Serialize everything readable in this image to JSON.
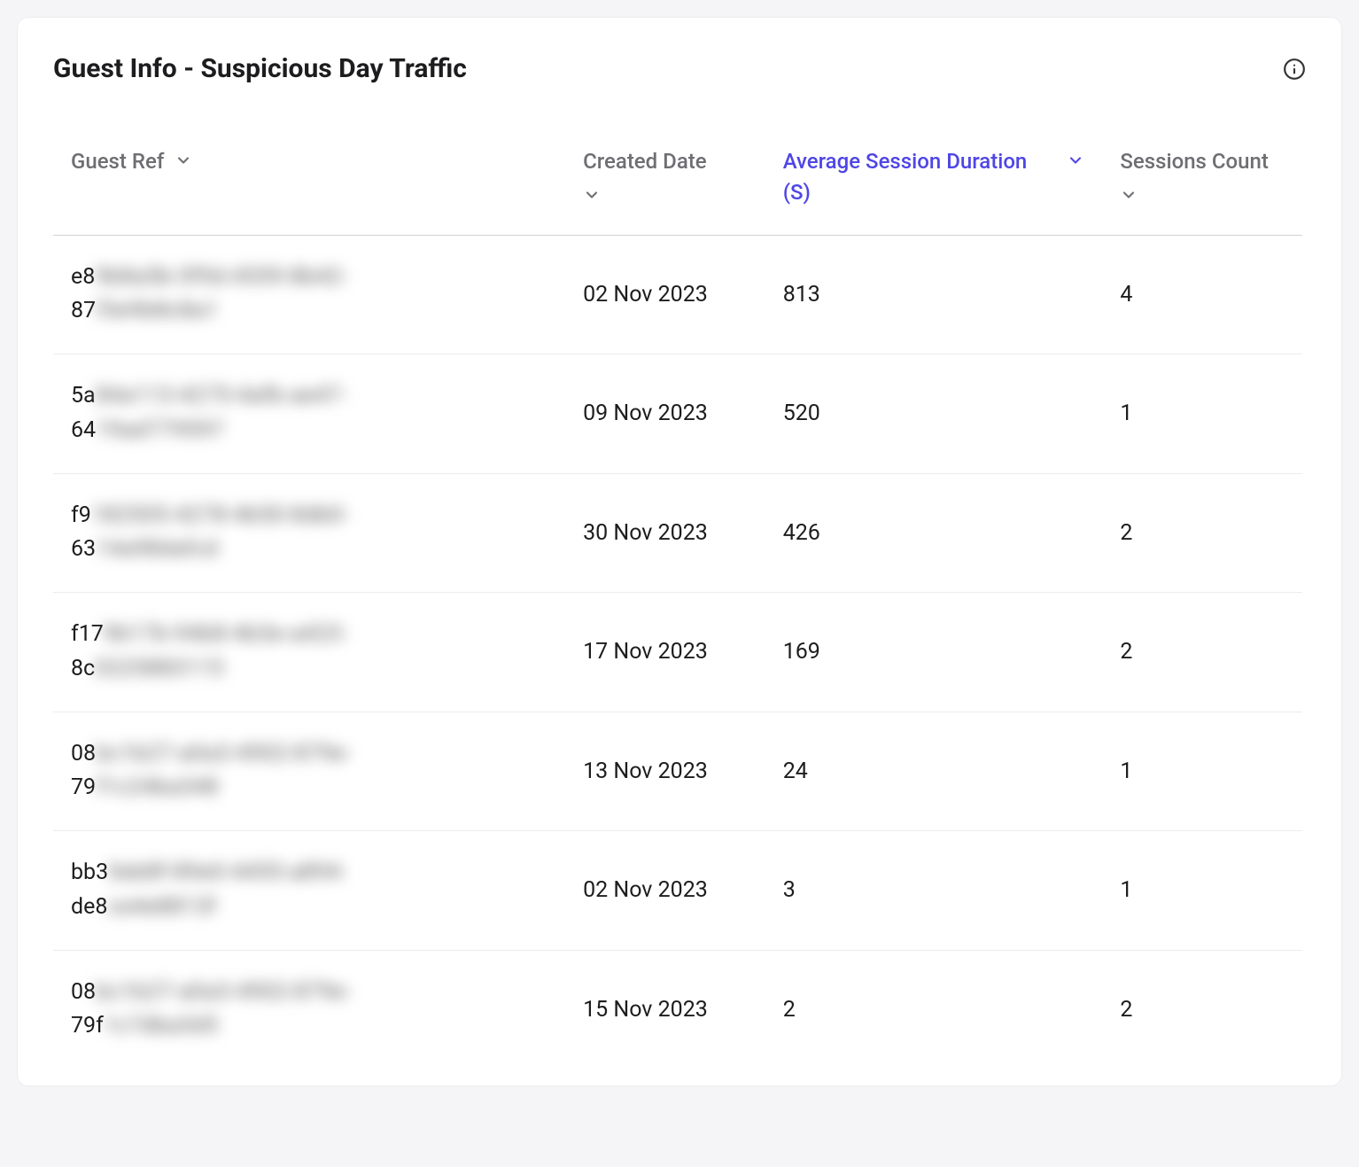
{
  "card": {
    "title": "Guest Info - Suspicious Day Traffic"
  },
  "table": {
    "columns": [
      {
        "key": "guest_ref",
        "label": "Guest Ref",
        "sorted": false,
        "chevron_inline": true
      },
      {
        "key": "created_date",
        "label": "Created Date",
        "sorted": false,
        "chevron_inline": false
      },
      {
        "key": "avg_session",
        "label": "Average Session Duration (S)",
        "sorted": true,
        "chevron_inline": true
      },
      {
        "key": "sessions_count",
        "label": "Sessions Count",
        "sorted": false,
        "chevron_inline": false
      }
    ],
    "rows": [
      {
        "guest_ref_line1_prefix": "e8",
        "guest_ref_line1_masked": "9b8a5b-5f9d-4559-8b42-",
        "guest_ref_line2_prefix": "87",
        "guest_ref_line2_masked": "f3e9b8c8a1",
        "created_date": "02 Nov 2023",
        "avg_session": "813",
        "sessions_count": "4"
      },
      {
        "guest_ref_line1_prefix": "5a",
        "guest_ref_line1_masked": "84a113-4275-4afb-ae47-",
        "guest_ref_line2_prefix": "64",
        "guest_ref_line2_masked": "19ad779597",
        "created_date": "09 Nov 2023",
        "avg_session": "520",
        "sessions_count": "1"
      },
      {
        "guest_ref_line1_prefix": "f9",
        "guest_ref_line1_masked": "182505-4278-4b50-8db0-",
        "guest_ref_line2_prefix": "63",
        "guest_ref_line2_masked": "14a98dafcd",
        "created_date": "30 Nov 2023",
        "avg_session": "426",
        "sessions_count": "2"
      },
      {
        "guest_ref_line1_prefix": "f17",
        "guest_ref_line1_masked": "9b17b-94b8-4b3e-a423-",
        "guest_ref_line2_prefix": "8c",
        "guest_ref_line2_masked": "0225883115",
        "created_date": "17 Nov 2023",
        "avg_session": "169",
        "sessions_count": "2"
      },
      {
        "guest_ref_line1_prefix": "08",
        "guest_ref_line1_masked": "bc1b27-a0a3-4902-879e-",
        "guest_ref_line2_prefix": "79",
        "guest_ref_line2_masked": "f1c24ba348",
        "created_date": "13 Nov 2023",
        "avg_session": "24",
        "sessions_count": "1"
      },
      {
        "guest_ref_line1_prefix": "bb3",
        "guest_ref_line1_masked": "0eb8f-89e0-4455-a894-",
        "guest_ref_line2_prefix": "de8",
        "guest_ref_line2_masked": "ce4e8813f",
        "created_date": "02 Nov 2023",
        "avg_session": "3",
        "sessions_count": "1"
      },
      {
        "guest_ref_line1_prefix": "08",
        "guest_ref_line1_masked": "bc1b27-a0a3-4902-879e-",
        "guest_ref_line2_prefix": "79f",
        "guest_ref_line2_masked": "1c7dba3d5",
        "created_date": "15 Nov 2023",
        "avg_session": "2",
        "sessions_count": "2"
      }
    ]
  }
}
